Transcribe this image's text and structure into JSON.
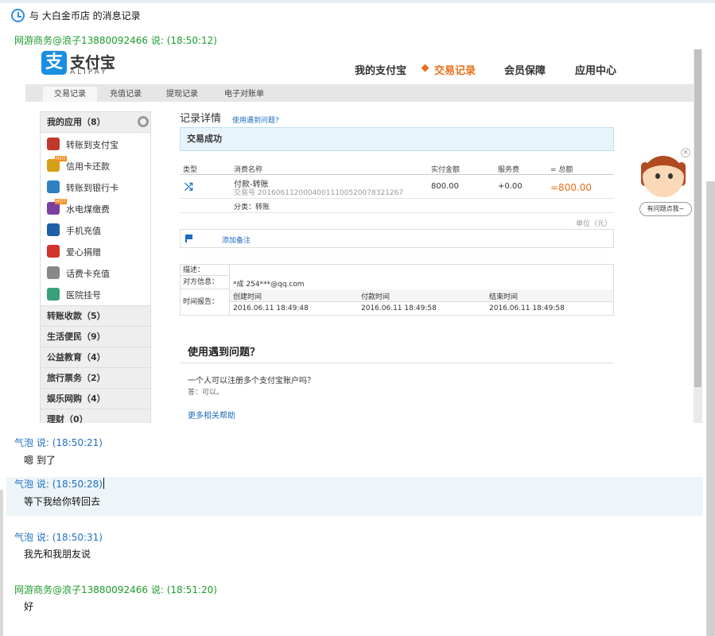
{
  "window": {
    "title": "与 大白金币店 的消息记录"
  },
  "messages": [
    {
      "sender": "网游商务@浪子13880092466",
      "says": "说:",
      "time": "(18:50:12)"
    },
    {
      "sender": "气泡",
      "says": "说:",
      "time": "(18:50:21)",
      "text": "嗯 到了"
    },
    {
      "sender": "气泡",
      "says": "说:",
      "time": "(18:50:28)",
      "text": "等下我给你转回去"
    },
    {
      "sender": "气泡",
      "says": "说:",
      "time": "(18:50:31)",
      "text": "我先和我朋友说"
    },
    {
      "sender": "网游商务@浪子13880092466",
      "says": "说:",
      "time": "(18:51:20)",
      "text": "好"
    }
  ],
  "alipay": {
    "brand": "支付宝",
    "brand_sub": "ALIPAY",
    "logo_char": "支",
    "nav": [
      "我的支付宝",
      "交易记录",
      "会员保障",
      "应用中心"
    ],
    "tabs": [
      "交易记录",
      "充值记录",
      "提现记录",
      "电子对账单"
    ],
    "sidebar": {
      "header": "我的应用（8）",
      "items": [
        {
          "label": "转账到支付宝",
          "color": "#c0392b",
          "hot": false
        },
        {
          "label": "信用卡还款",
          "color": "#d4a017",
          "hot": true
        },
        {
          "label": "转账到银行卡",
          "color": "#2f80c0",
          "hot": false
        },
        {
          "label": "水电煤缴费",
          "color": "#7b3fa0",
          "hot": true
        },
        {
          "label": "手机充值",
          "color": "#1f5fa8",
          "hot": false
        },
        {
          "label": "爱心捐赠",
          "color": "#d0342c",
          "hot": false
        },
        {
          "label": "话费卡充值",
          "color": "#888888",
          "hot": false
        },
        {
          "label": "医院挂号",
          "color": "#3aa07a",
          "hot": false
        }
      ],
      "hot_label": "HOT",
      "categories": [
        "转账收款（5）",
        "生活便民（9）",
        "公益教育（4）",
        "旅行票务（2）",
        "娱乐网购（4）",
        "理财（0）"
      ]
    },
    "record": {
      "title": "记录详情",
      "help_link": "使用遇到问题?",
      "status": "交易成功",
      "columns": [
        "类型",
        "消费名称",
        "实付金额",
        "服务费",
        "= 总额"
      ],
      "row": {
        "name": "付款-转账",
        "trade_no": "交易号 20160611200040011100520078321267",
        "amount": "800.00",
        "fee": "+0.00",
        "total": "=800.00"
      },
      "category": "分类：转账",
      "unit": "单位（元）",
      "add_note": "添加备注",
      "desc_label": "描述：",
      "party_label": "对方信息：",
      "party_value": "*成 254***@qq.com",
      "time_label": "时间报告：",
      "time_cols": [
        "创建时间",
        "付款时间",
        "结束时间"
      ],
      "time_vals": [
        "2016.06.11 18:49:48",
        "2016.06.11 18:49:58",
        "2016.06.11 18:49:58"
      ]
    },
    "help": {
      "title": "使用遇到问题？",
      "question": "一个人可以注册多个支付宝账户吗？",
      "answer": "答：可以。",
      "more": "更多相关帮助"
    },
    "assistant": {
      "bubble": "有问题点我~",
      "close": "×"
    }
  }
}
